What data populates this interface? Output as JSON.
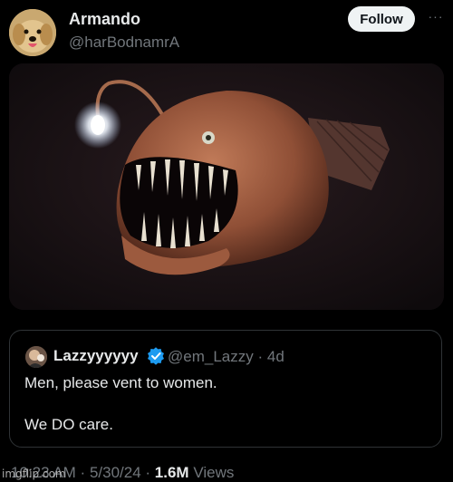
{
  "post": {
    "author": {
      "name": "Armando",
      "handle": "@harBodnamrA",
      "avatar_icon": "golden-retriever-puppy-avatar"
    },
    "follow_label": "Follow",
    "more_label": "···",
    "media_icon": "anglerfish-image"
  },
  "quote": {
    "author": {
      "name": "Lazzyyyyyy",
      "handle": "@em_Lazzy",
      "time": "4d",
      "verified_icon": "verified-badge-icon",
      "verified_color": "#1d9bf0"
    },
    "line1": "Men, please vent to women.",
    "line2": "We DO care."
  },
  "footer": {
    "time": "10:23 AM",
    "date": "5/30/24",
    "views_count": "1.6M",
    "views_label": "Views"
  },
  "watermark": "imgflip.com"
}
